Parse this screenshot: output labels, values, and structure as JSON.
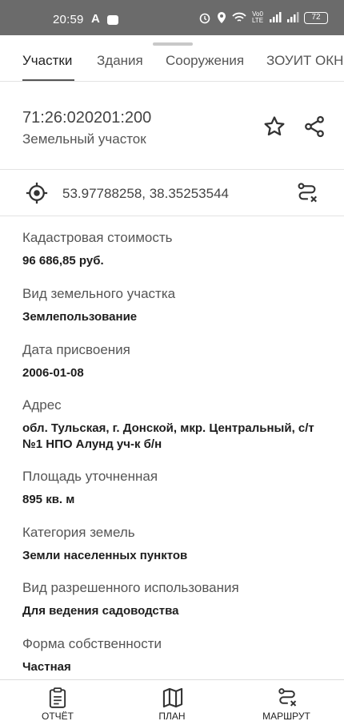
{
  "status_bar": {
    "time": "20:59",
    "app_letter": "A",
    "volte": "Vo0 LTE",
    "battery": "72"
  },
  "tabs": [
    {
      "label": "Участки",
      "active": true
    },
    {
      "label": "Здания",
      "active": false
    },
    {
      "label": "Сооружения",
      "active": false
    },
    {
      "label": "ЗОУИТ ОКН",
      "active": false
    }
  ],
  "object": {
    "cadastral_number": "71:26:020201:200",
    "type": "Земельный участок"
  },
  "coordinates": "53.97788258, 38.35253544",
  "properties": [
    {
      "label": "Кадастровая стоимость",
      "value": "96 686,85 руб."
    },
    {
      "label": "Вид земельного участка",
      "value": "Землепользование"
    },
    {
      "label": "Дата присвоения",
      "value": "2006-01-08"
    },
    {
      "label": "Адрес",
      "value": "обл. Тульская, г. Донской, мкр. Центральный, с/т №1 НПО Алунд уч-к б/н"
    },
    {
      "label": "Площадь уточненная",
      "value": "895 кв. м"
    },
    {
      "label": "Категория земель",
      "value": "Земли населенных пунктов"
    },
    {
      "label": "Вид разрешенного использования",
      "value": "Для ведения садоводства"
    },
    {
      "label": "Форма собственности",
      "value": "Частная"
    }
  ],
  "bottom_nav": [
    {
      "label": "ОТЧЁТ",
      "icon": "report-icon"
    },
    {
      "label": "ПЛАН",
      "icon": "map-icon"
    },
    {
      "label": "МАРШРУТ",
      "icon": "route-icon"
    }
  ]
}
